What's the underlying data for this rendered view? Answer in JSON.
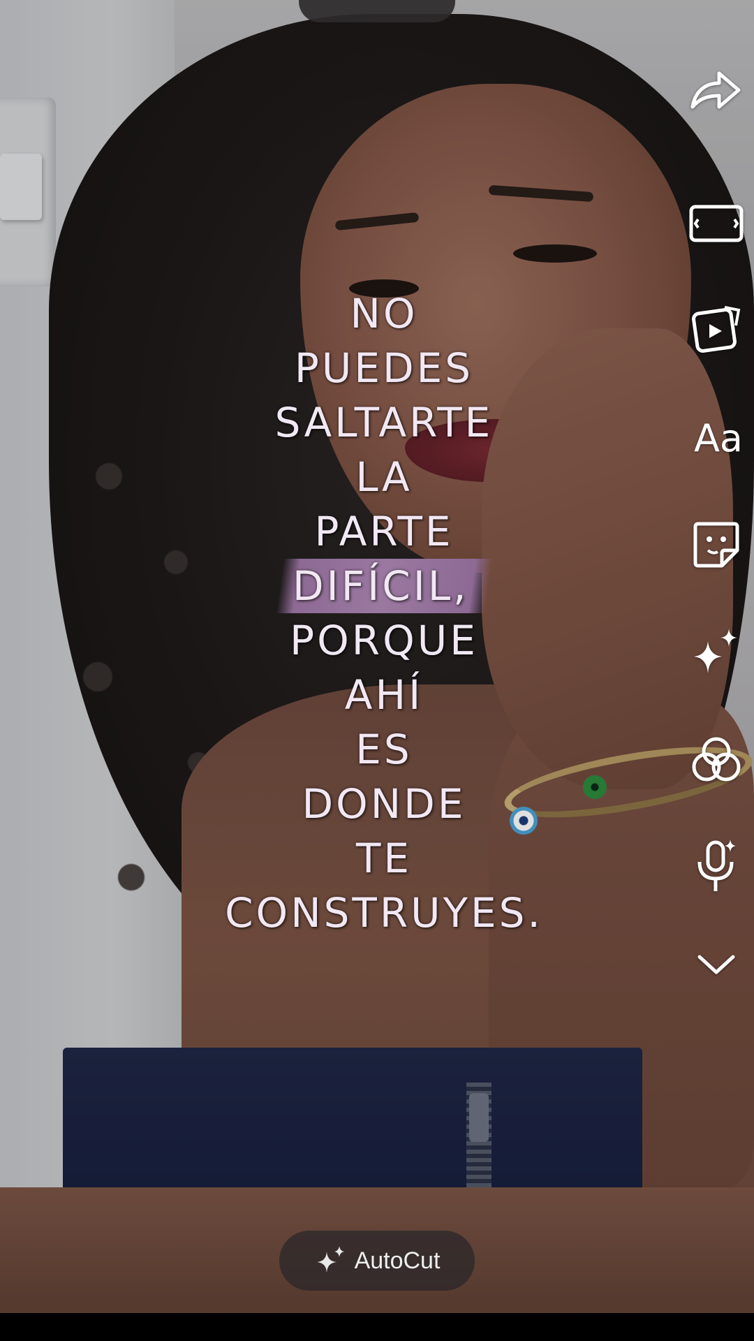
{
  "caption": {
    "lines": [
      "NO",
      "PUEDES",
      "SALTARTE",
      "LA",
      "PARTE",
      "DIFÍCIL,",
      "PORQUE",
      "AHÍ",
      "ES",
      "DONDE",
      "TE",
      "CONSTRUYES."
    ],
    "highlighted_line_index": 5,
    "text_color": "#f2e8f4",
    "highlight_color": "#9a78a0"
  },
  "toolbar": {
    "items": [
      {
        "icon": "share-icon"
      },
      {
        "icon": "aspect-ratio-icon"
      },
      {
        "icon": "video-clips-icon"
      },
      {
        "icon": "text-icon",
        "label": "Aa"
      },
      {
        "icon": "sticker-icon"
      },
      {
        "icon": "effects-sparkle-icon"
      },
      {
        "icon": "filters-icon"
      },
      {
        "icon": "voice-effects-icon"
      },
      {
        "icon": "chevron-down-icon"
      }
    ]
  },
  "autocut": {
    "label": "AutoCut",
    "icon": "sparkle-icon"
  }
}
